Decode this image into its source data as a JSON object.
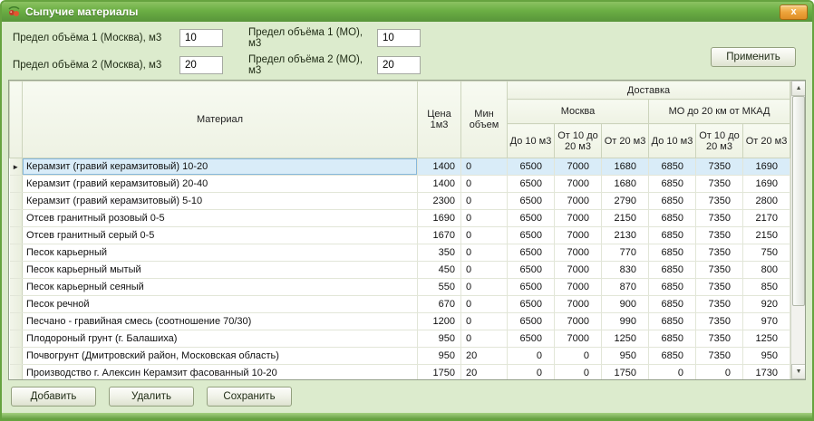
{
  "window": {
    "title": "Сыпучие материалы",
    "close_label": "x"
  },
  "colors": {
    "titlebar_green": "#6bae44",
    "window_background": "#dcebcd",
    "close_button_orange": "#eda43c",
    "selected_row": "#d9ecf8",
    "grid_header": "#eef2e3"
  },
  "filters": {
    "fields": [
      {
        "label": "Предел объёма 1 (Москва), м3",
        "value": "10"
      },
      {
        "label": "Предел объёма 1 (МО), м3",
        "value": "10"
      },
      {
        "label": "Предел объёма 2 (Москва), м3",
        "value": "20"
      },
      {
        "label": "Предел объёма 2 (МО), м3",
        "value": "20"
      }
    ],
    "apply_label": "Применить"
  },
  "table": {
    "headers": {
      "material": "Материал",
      "price": "Цена 1м3",
      "min_volume": "Мин объем",
      "delivery": "Доставка",
      "moscow": "Москва",
      "mo": "МО до 20 км от МКАД",
      "tier1": "До 10 м3",
      "tier2": "От 10 до 20 м3",
      "tier3": "От 20 м3"
    },
    "selected_index": 0,
    "rows": [
      {
        "material": "Керамзит (гравий керамзитовый) 10-20",
        "price": "1400",
        "min": "0",
        "msk1": "6500",
        "msk2": "7000",
        "msk3": "1680",
        "mo1": "6850",
        "mo2": "7350",
        "mo3": "1690"
      },
      {
        "material": "Керамзит (гравий керамзитовый) 20-40",
        "price": "1400",
        "min": "0",
        "msk1": "6500",
        "msk2": "7000",
        "msk3": "1680",
        "mo1": "6850",
        "mo2": "7350",
        "mo3": "1690"
      },
      {
        "material": "Керамзит (гравий керамзитовый) 5-10",
        "price": "2300",
        "min": "0",
        "msk1": "6500",
        "msk2": "7000",
        "msk3": "2790",
        "mo1": "6850",
        "mo2": "7350",
        "mo3": "2800"
      },
      {
        "material": "Отсев гранитный розовый 0-5",
        "price": "1690",
        "min": "0",
        "msk1": "6500",
        "msk2": "7000",
        "msk3": "2150",
        "mo1": "6850",
        "mo2": "7350",
        "mo3": "2170"
      },
      {
        "material": "Отсев гранитный серый 0-5",
        "price": "1670",
        "min": "0",
        "msk1": "6500",
        "msk2": "7000",
        "msk3": "2130",
        "mo1": "6850",
        "mo2": "7350",
        "mo3": "2150"
      },
      {
        "material": "Песок карьерный",
        "price": "350",
        "min": "0",
        "msk1": "6500",
        "msk2": "7000",
        "msk3": "770",
        "mo1": "6850",
        "mo2": "7350",
        "mo3": "750"
      },
      {
        "material": "Песок карьерный мытый",
        "price": "450",
        "min": "0",
        "msk1": "6500",
        "msk2": "7000",
        "msk3": "830",
        "mo1": "6850",
        "mo2": "7350",
        "mo3": "800"
      },
      {
        "material": "Песок карьерный сеяный",
        "price": "550",
        "min": "0",
        "msk1": "6500",
        "msk2": "7000",
        "msk3": "870",
        "mo1": "6850",
        "mo2": "7350",
        "mo3": "850"
      },
      {
        "material": "Песок речной",
        "price": "670",
        "min": "0",
        "msk1": "6500",
        "msk2": "7000",
        "msk3": "900",
        "mo1": "6850",
        "mo2": "7350",
        "mo3": "920"
      },
      {
        "material": "Песчано - гравийная смесь (соотношение 70/30)",
        "price": "1200",
        "min": "0",
        "msk1": "6500",
        "msk2": "7000",
        "msk3": "990",
        "mo1": "6850",
        "mo2": "7350",
        "mo3": "970"
      },
      {
        "material": "Плодороный грунт (г. Балашиха)",
        "price": "950",
        "min": "0",
        "msk1": "6500",
        "msk2": "7000",
        "msk3": "1250",
        "mo1": "6850",
        "mo2": "7350",
        "mo3": "1250"
      },
      {
        "material": "Почвогрунт (Дмитровский район, Московская область)",
        "price": "950",
        "min": "20",
        "msk1": "0",
        "msk2": "0",
        "msk3": "950",
        "mo1": "6850",
        "mo2": "7350",
        "mo3": "950"
      },
      {
        "material": "Производство г. Алексин Керамзит фасованный 10-20",
        "price": "1750",
        "min": "20",
        "msk1": "0",
        "msk2": "0",
        "msk3": "1750",
        "mo1": "0",
        "mo2": "0",
        "mo3": "1730"
      }
    ]
  },
  "scrollbar": {
    "up_glyph": "▲",
    "down_glyph": "▼"
  },
  "footer": {
    "add_label": "Добавить",
    "delete_label": "Удалить",
    "save_label": "Сохранить"
  }
}
